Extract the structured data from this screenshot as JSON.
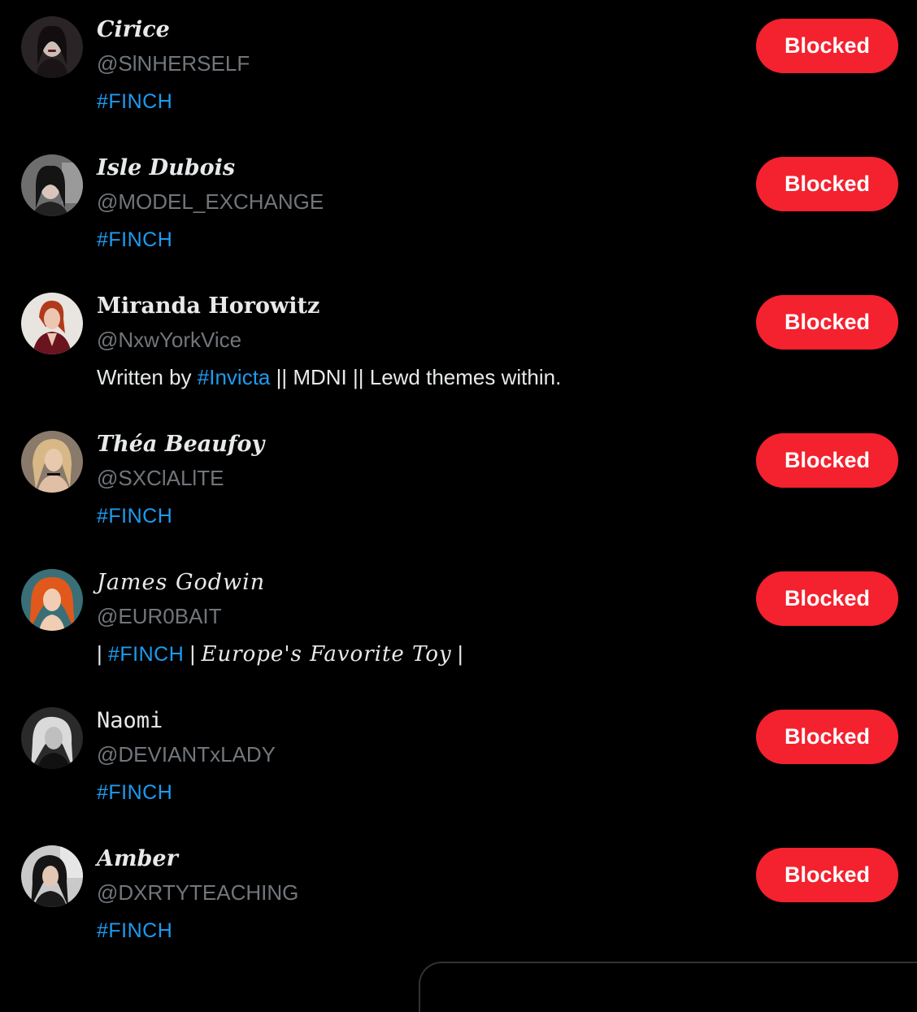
{
  "colors": {
    "background": "#000000",
    "primary_text": "#e7e9ea",
    "secondary_text": "#71767b",
    "link": "#1d9bf0",
    "blocked_button": "#f4212e"
  },
  "users": [
    {
      "display_name": "Cirice",
      "handle": "@SlNHERSELF",
      "bio_pre": "",
      "bio_tag": "#FINCH",
      "bio_post": "",
      "button_label": "Blocked"
    },
    {
      "display_name": "Isle Dubois",
      "handle": "@MODEL_EXCHANGE",
      "bio_pre": "",
      "bio_tag": "#FINCH",
      "bio_post": "",
      "button_label": "Blocked"
    },
    {
      "display_name": "Miranda Horowitz",
      "handle": "@NxwYorkVice",
      "bio_pre": "Written by ",
      "bio_tag": "#Invicta",
      "bio_post": " || MDNI || Lewd themes within.",
      "button_label": "Blocked"
    },
    {
      "display_name": "Théa Beaufoy",
      "handle": "@SXClALlTE",
      "bio_pre": "",
      "bio_tag": "#FINCH",
      "bio_post": "",
      "button_label": "Blocked"
    },
    {
      "display_name": "James Godwin",
      "handle": "@EUR0BAIT",
      "bio_pre": "| ",
      "bio_tag": "#FINCH",
      "bio_post": " | ",
      "bio_script": "Europe's Favorite Toy",
      "bio_end": " |",
      "button_label": "Blocked"
    },
    {
      "display_name": "Naomi",
      "handle": "@DEVIANTxLADY",
      "bio_pre": "",
      "bio_tag": "#FINCH",
      "bio_post": "",
      "button_label": "Blocked"
    },
    {
      "display_name": "Amber",
      "handle": "@DXRTYTEACHING",
      "bio_pre": "",
      "bio_tag": "#FINCH",
      "bio_post": "",
      "button_label": "Blocked"
    }
  ]
}
